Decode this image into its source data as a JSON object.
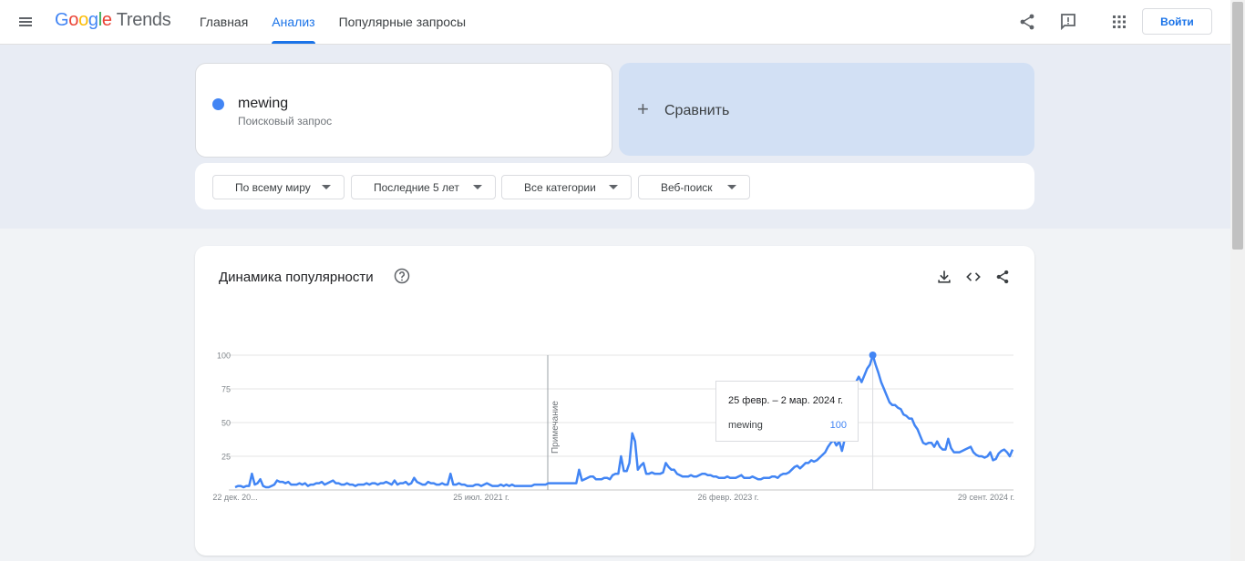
{
  "header": {
    "logo_google": [
      "G",
      "o",
      "o",
      "g",
      "l",
      "e"
    ],
    "logo_trends": "Trends",
    "nav": [
      {
        "label": "Главная",
        "active": false
      },
      {
        "label": "Анализ",
        "active": true
      },
      {
        "label": "Популярные запросы",
        "active": false
      }
    ],
    "signin_label": "Войти",
    "icons": [
      "menu-icon",
      "share-icon",
      "feedback-icon",
      "apps-icon"
    ]
  },
  "search": {
    "term": "mewing",
    "term_type": "Поисковый запрос",
    "term_color": "#4285f4",
    "compare_plus": "+",
    "compare_label": "Сравнить"
  },
  "filters": [
    {
      "label": "По всему миру"
    },
    {
      "label": "Последние 5 лет"
    },
    {
      "label": "Все категории"
    },
    {
      "label": "Веб-поиск"
    }
  ],
  "card": {
    "title": "Динамика популярности",
    "icons": [
      "help-icon",
      "download-icon",
      "embed-icon",
      "share-icon"
    ]
  },
  "tooltip": {
    "date": "25 февр. – 2 мар. 2024 г.",
    "term": "mewing",
    "value": "100"
  },
  "chart_data": {
    "type": "line",
    "title": "",
    "xlabel": "",
    "ylabel": "",
    "ylim": [
      0,
      100
    ],
    "yticks": [
      100,
      75,
      50,
      25
    ],
    "xtick_labels": [
      "22 дек. 20...",
      "25 июл. 2021 г.",
      "26 февр. 2023 г.",
      "29 сент. 2024 г."
    ],
    "note_label": "Примечание",
    "grid": true,
    "series": [
      {
        "name": "mewing",
        "color": "#4285f4",
        "values": [
          2,
          3,
          3,
          2,
          3,
          3,
          12,
          4,
          5,
          8,
          3,
          2,
          2,
          3,
          4,
          7,
          6,
          6,
          5,
          6,
          4,
          4,
          4,
          5,
          4,
          5,
          3,
          4,
          4,
          5,
          5,
          6,
          4,
          5,
          6,
          7,
          5,
          5,
          4,
          4,
          5,
          4,
          4,
          3,
          4,
          4,
          4,
          5,
          4,
          5,
          5,
          4,
          5,
          5,
          6,
          5,
          4,
          7,
          4,
          5,
          5,
          6,
          4,
          5,
          9,
          6,
          5,
          4,
          4,
          6,
          5,
          5,
          4,
          4,
          5,
          4,
          4,
          12,
          4,
          4,
          5,
          4,
          4,
          3,
          3,
          3,
          4,
          4,
          3,
          4,
          5,
          4,
          3,
          3,
          3,
          4,
          3,
          4,
          3,
          4,
          3,
          3,
          3,
          3,
          3,
          3,
          3,
          4,
          4,
          4,
          4,
          4,
          5,
          5,
          5,
          5,
          5,
          5,
          5,
          5,
          5,
          5,
          5,
          15,
          7,
          8,
          9,
          10,
          10,
          8,
          8,
          8,
          9,
          9,
          8,
          11,
          12,
          12,
          25,
          14,
          14,
          20,
          42,
          36,
          15,
          18,
          20,
          12,
          12,
          13,
          12,
          12,
          12,
          13,
          20,
          17,
          15,
          15,
          12,
          11,
          10,
          10,
          10,
          11,
          10,
          10,
          11,
          12,
          12,
          11,
          11,
          10,
          10,
          9,
          9,
          9,
          10,
          9,
          9,
          9,
          10,
          11,
          9,
          9,
          9,
          10,
          9,
          8,
          8,
          9,
          9,
          9,
          10,
          10,
          9,
          11,
          12,
          12,
          13,
          15,
          17,
          18,
          16,
          18,
          20,
          20,
          22,
          21,
          22,
          24,
          26,
          28,
          32,
          35,
          37,
          33,
          36,
          29,
          38,
          46,
          55,
          65,
          80,
          84,
          80,
          85,
          90,
          93,
          100,
          93,
          87,
          80,
          75,
          70,
          65,
          63,
          63,
          61,
          60,
          56,
          55,
          53,
          53,
          48,
          45,
          40,
          35,
          34,
          35,
          35,
          32,
          36,
          32,
          30,
          30,
          38,
          31,
          28,
          28,
          28,
          29,
          30,
          31,
          32,
          28,
          26,
          25,
          25,
          24,
          25,
          28,
          22,
          23,
          27,
          29,
          30,
          28,
          25,
          30
        ]
      }
    ]
  }
}
